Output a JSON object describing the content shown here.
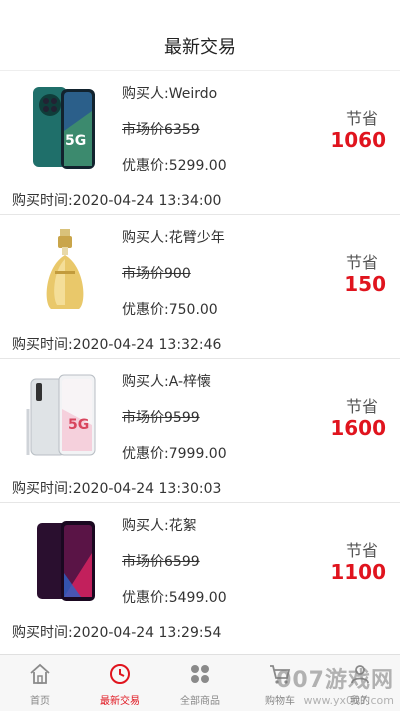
{
  "header": {
    "title": "最新交易"
  },
  "colors": {
    "accent": "#e0141e",
    "status_pill": "#2dbd4f"
  },
  "transactions": [
    {
      "product_icon": "phone-green-icon",
      "buyer": "购买人:Weirdo",
      "market_price": "市场价6359",
      "discount_price": "优惠价:5299.00",
      "save_label": "节省",
      "save_amount": "1060",
      "time": "购买时间:2020-04-24 13:34:00"
    },
    {
      "product_icon": "perfume-icon",
      "buyer": "购买人:花臂少年",
      "market_price": "市场价900",
      "discount_price": "优惠价:750.00",
      "save_label": "节省",
      "save_amount": "150",
      "time": "购买时间:2020-04-24 13:32:46"
    },
    {
      "product_icon": "phone-white-icon",
      "buyer": "购买人:A-梓懐",
      "market_price": "市场价9599",
      "discount_price": "优惠价:7999.00",
      "save_label": "节省",
      "save_amount": "1600",
      "time": "购买时间:2020-04-24 13:30:03"
    },
    {
      "product_icon": "phone-purple-icon",
      "buyer": "购买人:花絮",
      "market_price": "市场价6599",
      "discount_price": "优惠价:5499.00",
      "save_label": "节省",
      "save_amount": "1100",
      "time": "购买时间:2020-04-24 13:29:54"
    }
  ],
  "tabbar": {
    "items": [
      {
        "label": "首页",
        "icon": "home-icon",
        "active": false
      },
      {
        "label": "最新交易",
        "icon": "clock-icon",
        "active": true
      },
      {
        "label": "全部商品",
        "icon": "grid-icon",
        "active": false
      },
      {
        "label": "购物车",
        "icon": "cart-icon",
        "active": false
      },
      {
        "label": "我的",
        "icon": "user-icon",
        "active": false
      }
    ]
  },
  "watermark": {
    "big": "007游戏网",
    "small": "www.yx007.com"
  }
}
